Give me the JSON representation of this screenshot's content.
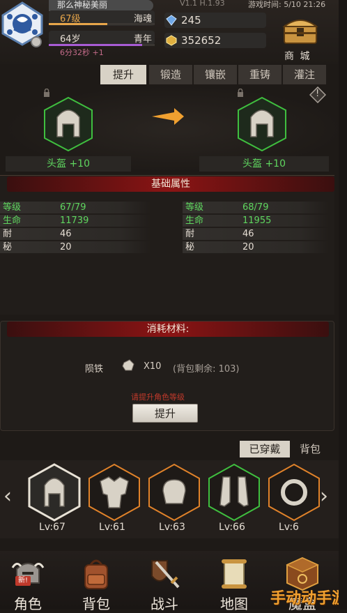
{
  "header": {
    "player_name": "那么神秘美丽",
    "level_text": "67级",
    "level_title": "海魂",
    "level_progress": 0.55,
    "age_text": "64岁",
    "age_title": "青年",
    "age_progress": 0.88,
    "timer": "6分32秒 +1",
    "version": "V1.1 H.1.93",
    "game_time": "游戏时间: 5/10 21:26",
    "gems": "245",
    "gold": "352652",
    "shop_label": "商 城"
  },
  "tabs": [
    {
      "label": "提升",
      "active": true
    },
    {
      "label": "锻造",
      "active": false
    },
    {
      "label": "镶嵌",
      "active": false
    },
    {
      "label": "重铸",
      "active": false
    },
    {
      "label": "灌注",
      "active": false
    }
  ],
  "upgrade": {
    "current_item": "头盔 +10",
    "next_item": "头盔 +10",
    "warning_icon": "!"
  },
  "attributes": {
    "title": "基础属性",
    "current": [
      {
        "label": "等级",
        "value": "67/79",
        "highlight": true
      },
      {
        "label": "生命",
        "value": "11739",
        "highlight": true
      },
      {
        "label": "耐",
        "value": "46",
        "highlight": false
      },
      {
        "label": "秘",
        "value": "20",
        "highlight": false
      }
    ],
    "next": [
      {
        "label": "等级",
        "value": "68/79",
        "highlight": true
      },
      {
        "label": "生命",
        "value": "11955",
        "highlight": true
      },
      {
        "label": "耐",
        "value": "46",
        "highlight": false
      },
      {
        "label": "秘",
        "value": "20",
        "highlight": false
      }
    ]
  },
  "materials": {
    "title": "消耗材料:",
    "name": "陨铁",
    "quantity": "X10",
    "remaining": "(背包剩余: 103)",
    "hint": "请提升角色等级",
    "button": "提升"
  },
  "inventory": {
    "tab_equipped": "已穿戴",
    "tab_bag": "背包",
    "items": [
      {
        "level": "Lv:67",
        "icon": "helmet-icon",
        "selected": true,
        "border": "#e8e2d6"
      },
      {
        "level": "Lv:61",
        "icon": "armor-icon",
        "selected": false,
        "border": "#e0822a"
      },
      {
        "level": "Lv:63",
        "icon": "gauntlet-icon",
        "selected": false,
        "border": "#e0822a"
      },
      {
        "level": "Lv:66",
        "icon": "boots-icon",
        "selected": false,
        "border": "#3fbf3f"
      },
      {
        "level": "Lv:6",
        "icon": "ring-icon",
        "selected": false,
        "border": "#e0822a"
      }
    ]
  },
  "bottom_nav": [
    {
      "label": "角色",
      "icon": "knight-helmet-icon"
    },
    {
      "label": "背包",
      "icon": "backpack-icon"
    },
    {
      "label": "战斗",
      "icon": "sword-shield-icon"
    },
    {
      "label": "地图",
      "icon": "scroll-map-icon"
    },
    {
      "label": "魔盒",
      "icon": "magic-box-icon"
    }
  ],
  "new_badge": "新!",
  "watermark": "手动动手游",
  "colors": {
    "green": "#5fd65f",
    "red_bar": "#8b1414",
    "gold_accent": "#e8a64a"
  }
}
